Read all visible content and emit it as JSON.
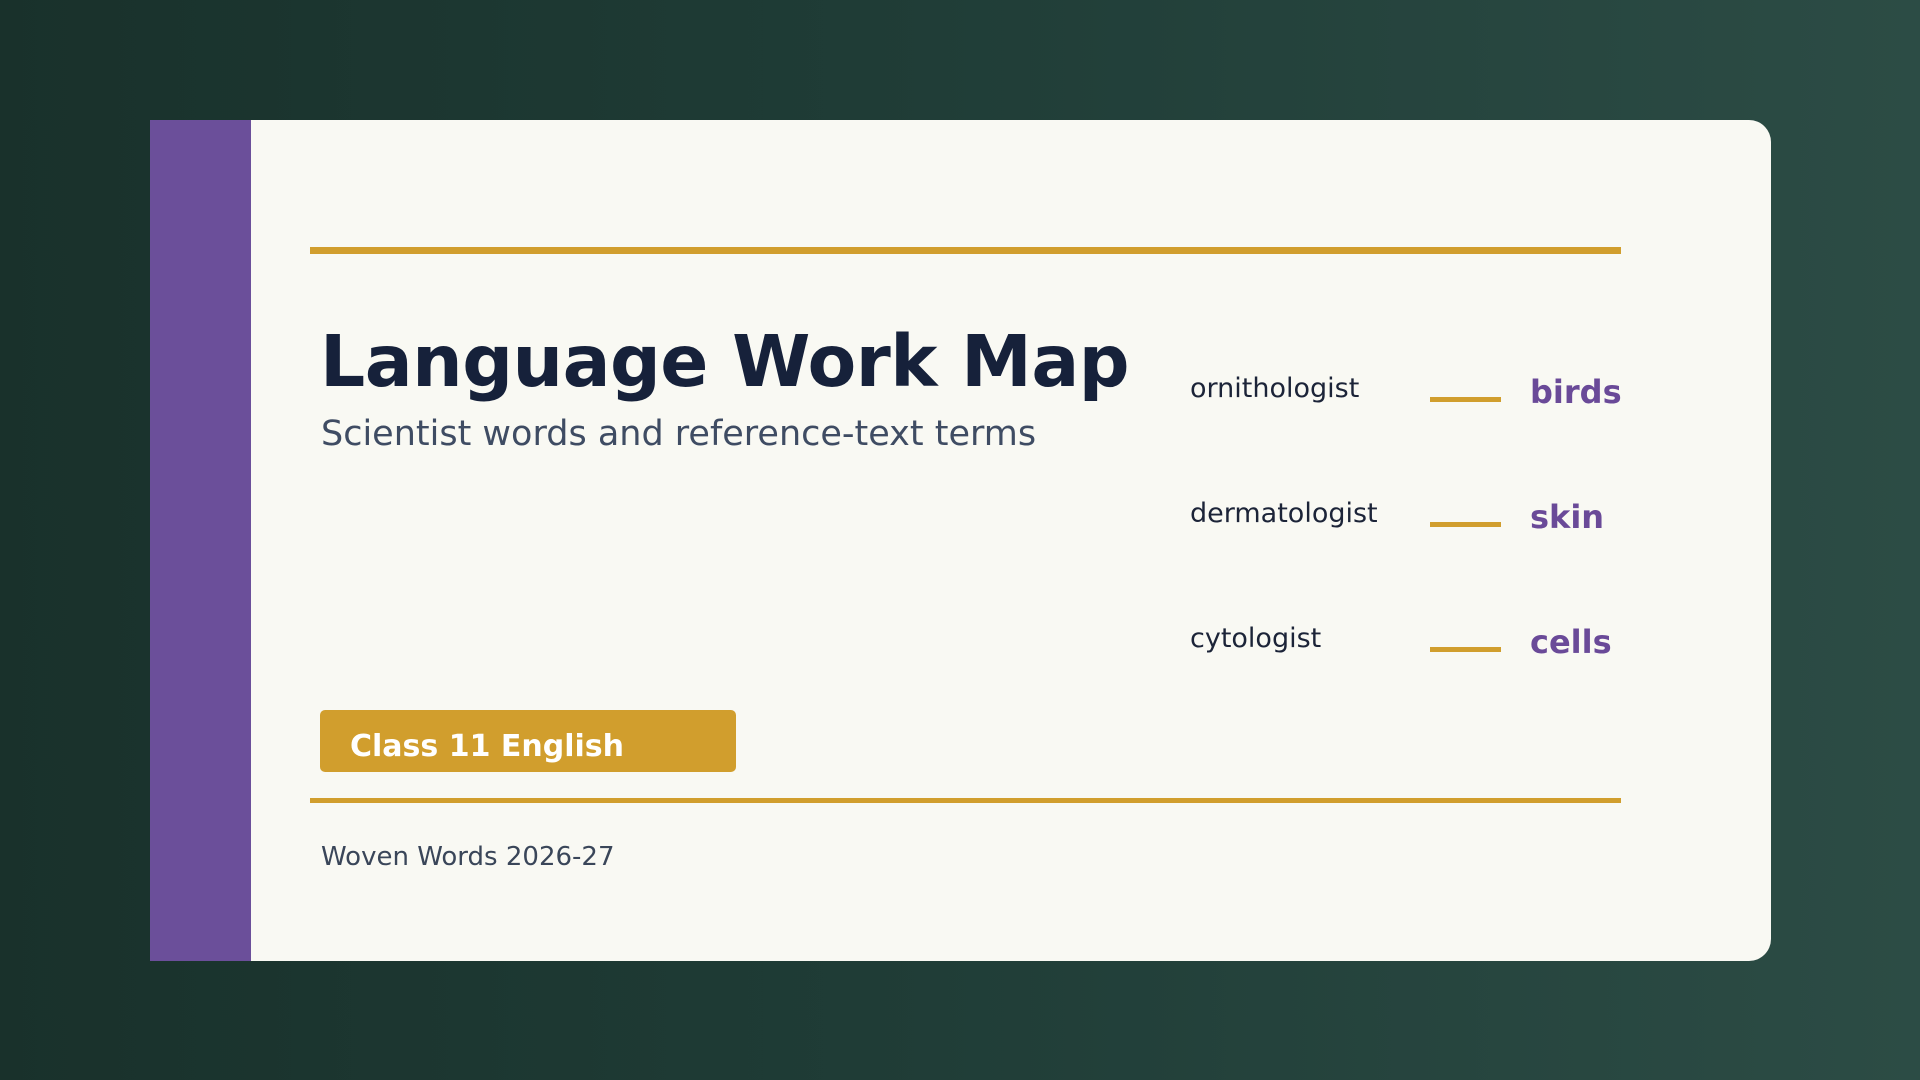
{
  "colors": {
    "spine": "#6b4f9a",
    "accent": "#d19e2d",
    "meaning": "#6a4a98"
  },
  "card": {
    "title": "Language Work Map",
    "subtitle": "Scientist words and reference-text terms",
    "badge": "Class 11 English",
    "footer": "Woven Words 2026-27"
  },
  "terms": [
    {
      "word": "ornithologist",
      "meaning": "birds"
    },
    {
      "word": "dermatologist",
      "meaning": "skin"
    },
    {
      "word": "cytologist",
      "meaning": "cells"
    }
  ]
}
